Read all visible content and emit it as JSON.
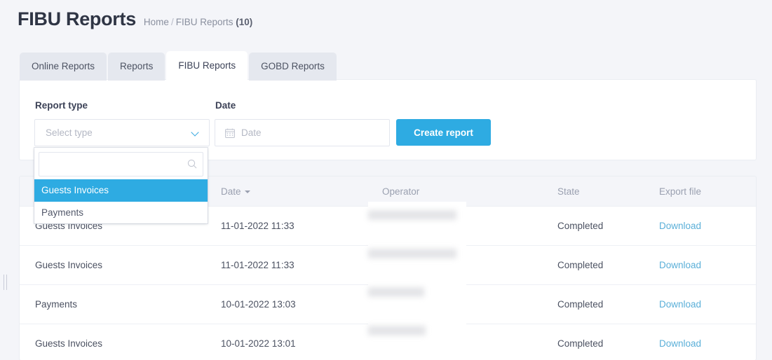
{
  "page": {
    "title": "FIBU Reports",
    "background_color": "#f4f5f9",
    "accent_color": "#2eabe2",
    "link_color": "#5aafd8"
  },
  "breadcrumb": {
    "home": "Home",
    "separator": "/",
    "current": "FIBU Reports",
    "count": "(10)"
  },
  "tabs": [
    {
      "label": "Online Reports",
      "active": false
    },
    {
      "label": "Reports",
      "active": false
    },
    {
      "label": "FIBU Reports",
      "active": true
    },
    {
      "label": "GOBD Reports",
      "active": false
    }
  ],
  "form": {
    "report_type": {
      "label": "Report type",
      "placeholder": "Select type",
      "value": "",
      "chevron_icon": "chevron-down-icon"
    },
    "date": {
      "label": "Date",
      "placeholder": "Date",
      "value": "",
      "icon": "calendar-icon"
    },
    "create_button": "Create report"
  },
  "dropdown": {
    "open": true,
    "search": {
      "value": "",
      "placeholder": "",
      "icon": "search-icon"
    },
    "options": [
      {
        "label": "Guests Invoices",
        "selected": true
      },
      {
        "label": "Payments",
        "selected": false
      }
    ]
  },
  "table": {
    "columns": [
      {
        "label": "",
        "sortable": false
      },
      {
        "label": "Date",
        "sortable": true,
        "sort_direction": "desc"
      },
      {
        "label": "Operator",
        "sortable": false
      },
      {
        "label": "State",
        "sortable": false
      },
      {
        "label": "Export file",
        "sortable": false
      }
    ],
    "rows": [
      {
        "type": "Guests Invoices",
        "date": "11-01-2022 11:33",
        "operator": "",
        "state": "Completed",
        "export": "Download"
      },
      {
        "type": "Guests Invoices",
        "date": "11-01-2022 11:33",
        "operator": "",
        "state": "Completed",
        "export": "Download"
      },
      {
        "type": "Payments",
        "date": "10-01-2022 13:03",
        "operator": "",
        "state": "Completed",
        "export": "Download"
      },
      {
        "type": "Guests Invoices",
        "date": "10-01-2022 13:01",
        "operator": "",
        "state": "Completed",
        "export": "Download"
      }
    ]
  },
  "edge_handle": {
    "icon": "drag-handle-icon"
  }
}
